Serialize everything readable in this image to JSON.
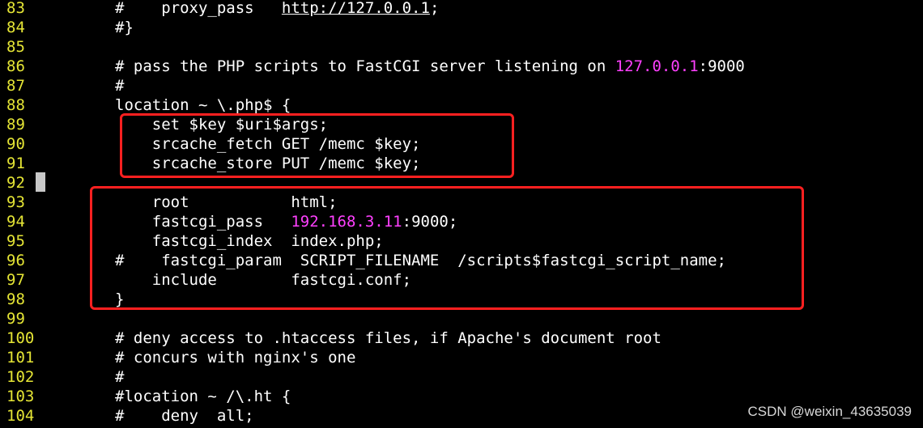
{
  "editor": {
    "lines": [
      {
        "number": "83",
        "segments": [
          {
            "text": "#    proxy_pass   "
          },
          {
            "text": "http://127.0.0.1",
            "style": "url"
          },
          {
            "text": ";"
          }
        ]
      },
      {
        "number": "84",
        "segments": [
          {
            "text": "#}"
          }
        ]
      },
      {
        "number": "85",
        "segments": []
      },
      {
        "number": "86",
        "segments": [
          {
            "text": "# pass the PHP scripts to FastCGI server listening on "
          },
          {
            "text": "127.0.0.1",
            "style": "num"
          },
          {
            "text": ":9000"
          }
        ]
      },
      {
        "number": "87",
        "segments": [
          {
            "text": "#"
          }
        ]
      },
      {
        "number": "88",
        "segments": [
          {
            "text": "location ~ \\.php$ {"
          }
        ]
      },
      {
        "number": "89",
        "segments": [
          {
            "text": "    set $key $uri$args;"
          }
        ]
      },
      {
        "number": "90",
        "segments": [
          {
            "text": "    srcache_fetch GET /memc $key;"
          }
        ]
      },
      {
        "number": "91",
        "segments": [
          {
            "text": "    srcache_store PUT /memc $key;"
          }
        ]
      },
      {
        "number": "92",
        "segments": []
      },
      {
        "number": "93",
        "segments": [
          {
            "text": "    root           html;"
          }
        ]
      },
      {
        "number": "94",
        "segments": [
          {
            "text": "    fastcgi_pass   "
          },
          {
            "text": "192.168.3.11",
            "style": "num"
          },
          {
            "text": ":9000;"
          }
        ]
      },
      {
        "number": "95",
        "segments": [
          {
            "text": "    fastcgi_index  index.php;"
          }
        ]
      },
      {
        "number": "96",
        "segments": [
          {
            "text": "#    fastcgi_param  SCRIPT_FILENAME  /scripts$fastcgi_script_name;"
          }
        ]
      },
      {
        "number": "97",
        "segments": [
          {
            "text": "    include        fastcgi.conf;"
          }
        ]
      },
      {
        "number": "98",
        "segments": [
          {
            "text": "}"
          }
        ]
      },
      {
        "number": "99",
        "segments": []
      },
      {
        "number": "100",
        "segments": [
          {
            "text": "# deny access to .htaccess files, if Apache's document root"
          }
        ]
      },
      {
        "number": "101",
        "segments": [
          {
            "text": "# concurs with nginx's one"
          }
        ]
      },
      {
        "number": "102",
        "segments": [
          {
            "text": "#"
          }
        ]
      },
      {
        "number": "103",
        "segments": [
          {
            "text": "#location ~ /\\.ht {"
          }
        ]
      },
      {
        "number": "104",
        "segments": [
          {
            "text": "#    deny  all;"
          }
        ]
      }
    ]
  },
  "watermark": "CSDN @weixin_43635039",
  "colors": {
    "background": "#000000",
    "line_number": "#e5e535",
    "text": "#ffffff",
    "number_literal": "#ff40ff",
    "highlight_box": "#ff2020"
  }
}
